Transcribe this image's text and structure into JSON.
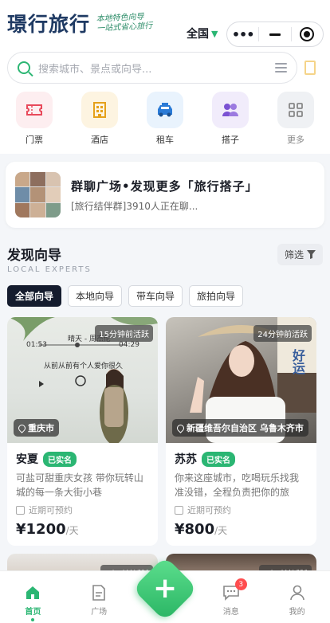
{
  "header": {
    "logo": "璟行旅行",
    "slogan_line1": "本地特色向导",
    "slogan_line2": "一站式省心旅行",
    "region": "全国"
  },
  "search": {
    "placeholder": "搜索城市、景点或向导..."
  },
  "categories": [
    {
      "label": "门票",
      "icon": "ticket-icon",
      "bg": "#fdeef0",
      "color": "#e8495b"
    },
    {
      "label": "酒店",
      "icon": "hotel-icon",
      "bg": "#fdf4e1",
      "color": "#e5a11b"
    },
    {
      "label": "租车",
      "icon": "car-icon",
      "bg": "#e9f3fd",
      "color": "#2a7ad6"
    },
    {
      "label": "搭子",
      "icon": "partner-icon",
      "bg": "#f1ecfb",
      "color": "#7b52d3"
    },
    {
      "label": "更多",
      "icon": "grid-icon",
      "bg": "#eff1f4",
      "color": "#888"
    }
  ],
  "banner": {
    "title": "群聊广场•发现更多「旅行搭子」",
    "subtitle": "[旅行结伴群]3910人正在聊..."
  },
  "section": {
    "title": "发现向导",
    "subtitle": "LOCAL EXPERTS",
    "filter": "筛选"
  },
  "tabs": [
    "全部向导",
    "本地向导",
    "带车向导",
    "旅拍向导"
  ],
  "guides": [
    {
      "name": "安夏",
      "badge": "已实名",
      "time": "15分钟前活跃",
      "location": "重庆市",
      "desc": "可盐可甜重庆女孩 带你玩转山城的每一条大街小巷",
      "appointment": "近期可预约",
      "price": "¥1200",
      "unit": "/天",
      "music": {
        "title": "晴天 - 周杰伦",
        "t1": "01:53",
        "t2": "04:29",
        "lyric": "从前从前有个人爱你很久"
      }
    },
    {
      "name": "苏苏",
      "badge": "已实名",
      "time": "24分钟前活跃",
      "location": "新疆维吾尔自治区 乌鲁木齐市",
      "desc": "你来这座城市，吃喝玩乐找我准没错，全程负责把你的旅途...",
      "appointment": "近期可预约",
      "price": "¥800",
      "unit": "/天",
      "sign": "好运"
    }
  ],
  "guides_more": [
    {
      "time": "1小时前活跃"
    },
    {
      "time": "3小时前活跃"
    }
  ],
  "tabbar": [
    {
      "label": "首页"
    },
    {
      "label": "广场"
    },
    {
      "label": "消息",
      "badge": "3"
    },
    {
      "label": "我的"
    }
  ]
}
